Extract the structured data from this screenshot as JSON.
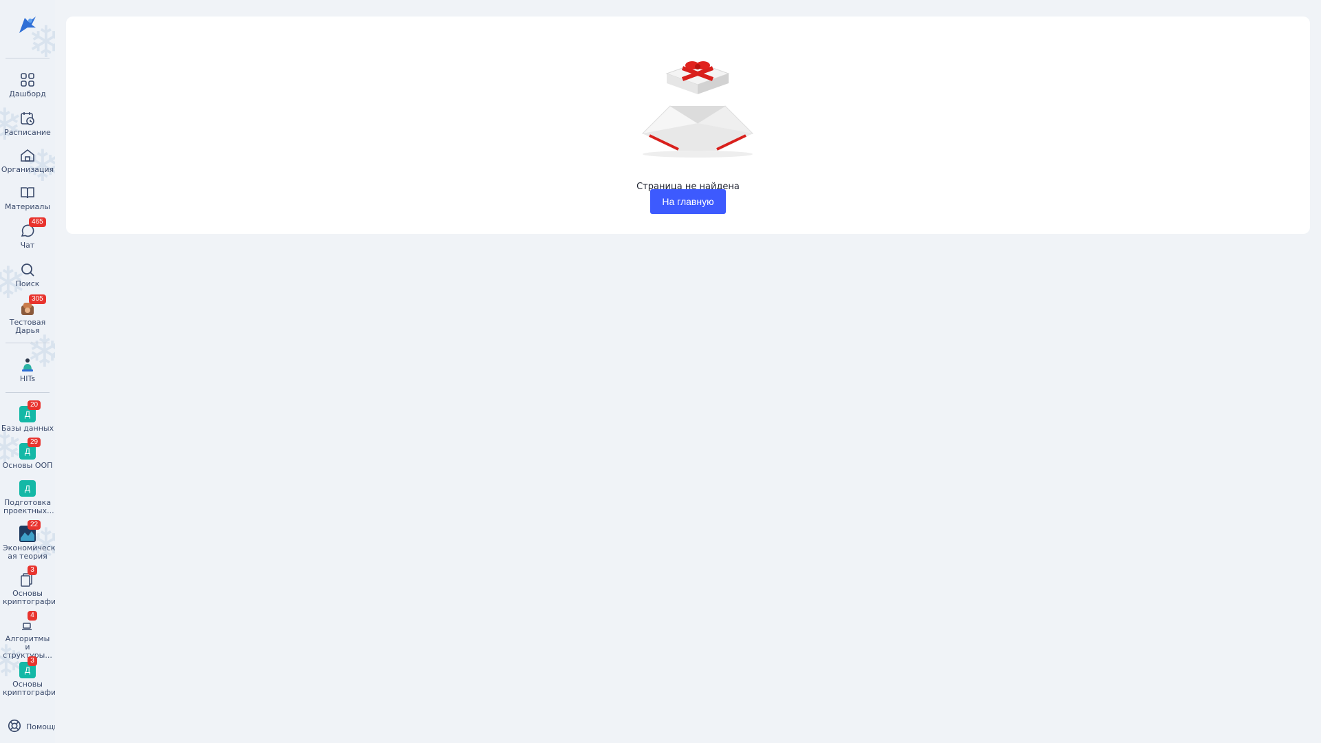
{
  "sidebar": {
    "items": [
      {
        "label": "Дашборд",
        "icon": "grid-icon"
      },
      {
        "label": "Расписание",
        "icon": "calendar-icon"
      },
      {
        "label": "Организация",
        "icon": "home-icon"
      },
      {
        "label": "Материалы",
        "icon": "book-icon"
      },
      {
        "label": "Чат",
        "icon": "chat-icon",
        "badge": "465"
      },
      {
        "label": "Поиск",
        "icon": "search-icon"
      },
      {
        "label": "Тестовая Дарья",
        "icon": "avatar",
        "badge": "305"
      },
      {
        "label": "HITs",
        "icon": "hits-logo"
      }
    ],
    "courses": [
      {
        "label": "Базы данных",
        "letter": "Д",
        "badge": "20"
      },
      {
        "label": "Основы ООП",
        "letter": "Д",
        "badge": "29"
      },
      {
        "label": "Подготовка проектных...",
        "letter": "Д"
      },
      {
        "label": "Экономическ ая теория",
        "badge": "22"
      },
      {
        "label": "Основы криптографии",
        "badge": "3"
      },
      {
        "label": "Алгоритмы и структуры...",
        "badge": "4"
      },
      {
        "label": "Основы криптографии",
        "letter": "Д",
        "badge": "3"
      }
    ],
    "help_label": "Помощь"
  },
  "main": {
    "not_found_text": "Страница не найдена",
    "home_button": "На главную"
  },
  "colors": {
    "accent": "#3d5afe",
    "badge": "#e8342e",
    "course_square": "#14b8a6"
  }
}
